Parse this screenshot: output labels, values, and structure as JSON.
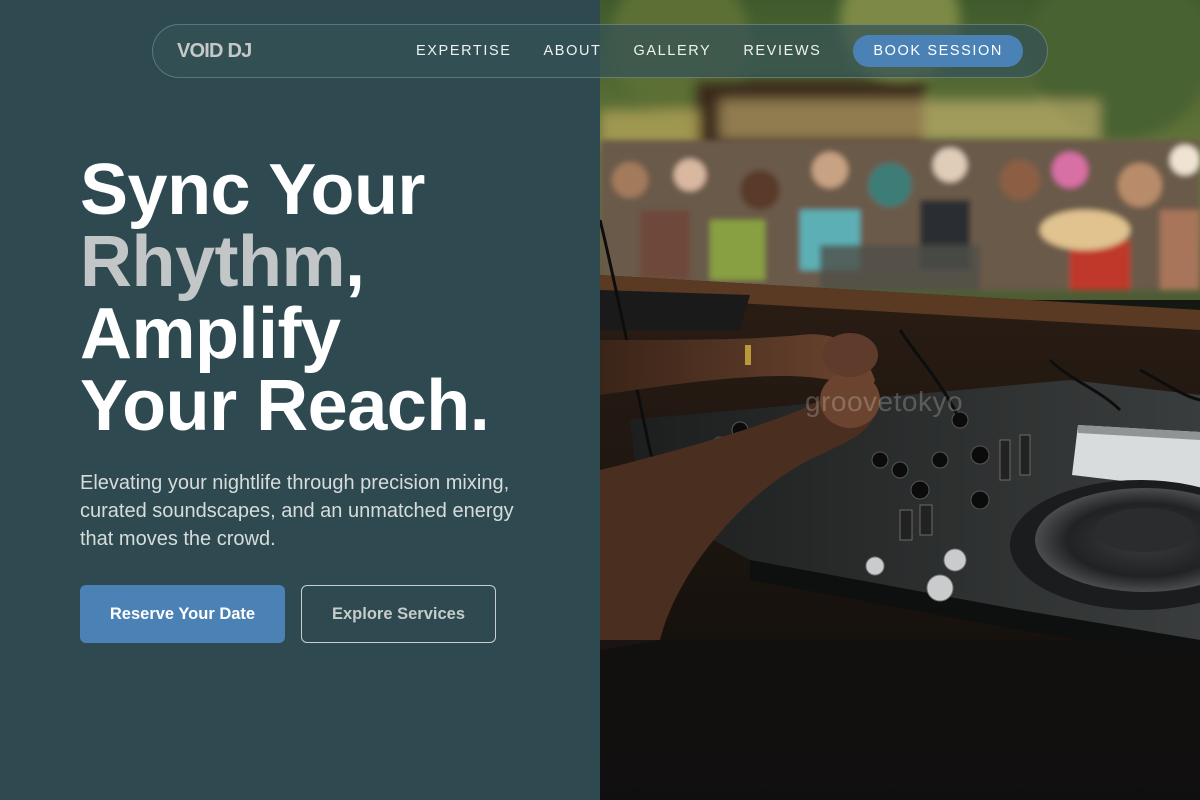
{
  "nav": {
    "logo": "VOID DJ",
    "links": [
      "EXPERTISE",
      "ABOUT",
      "GALLERY",
      "REVIEWS"
    ],
    "cta": "BOOK SESSION"
  },
  "hero": {
    "line1": "Sync Your",
    "line2_accent": "Rhythm",
    "line2_rest": ",",
    "line3": "Amplify",
    "line4": "Your Reach.",
    "subtitle": "Elevating your nightlife through precision mixing, curated soundscapes, and an unmatched energy that moves the crowd.",
    "primary_button": "Reserve Your Date",
    "secondary_button": "Explore Services"
  },
  "image": {
    "watermark": "groovetokyo"
  },
  "colors": {
    "background": "#2e4a50",
    "accent": "#4b82b6",
    "headline_accent": "#c2c6c6"
  }
}
